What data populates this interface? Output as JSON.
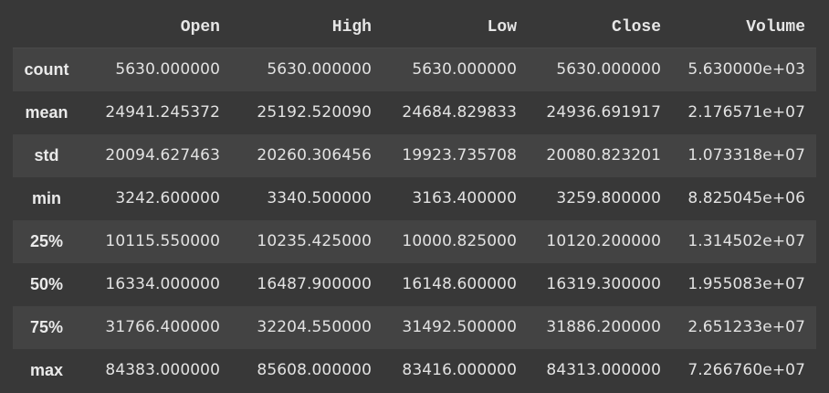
{
  "table": {
    "columns": [
      "Open",
      "High",
      "Low",
      "Close",
      "Volume"
    ],
    "rows": [
      {
        "label": "count",
        "values": [
          "5630.000000",
          "5630.000000",
          "5630.000000",
          "5630.000000",
          "5.630000e+03"
        ]
      },
      {
        "label": "mean",
        "values": [
          "24941.245372",
          "25192.520090",
          "24684.829833",
          "24936.691917",
          "2.176571e+07"
        ]
      },
      {
        "label": "std",
        "values": [
          "20094.627463",
          "20260.306456",
          "19923.735708",
          "20080.823201",
          "1.073318e+07"
        ]
      },
      {
        "label": "min",
        "values": [
          "3242.600000",
          "3340.500000",
          "3163.400000",
          "3259.800000",
          "8.825045e+06"
        ]
      },
      {
        "label": "25%",
        "values": [
          "10115.550000",
          "10235.425000",
          "10000.825000",
          "10120.200000",
          "1.314502e+07"
        ]
      },
      {
        "label": "50%",
        "values": [
          "16334.000000",
          "16487.900000",
          "16148.600000",
          "16319.300000",
          "1.955083e+07"
        ]
      },
      {
        "label": "75%",
        "values": [
          "31766.400000",
          "32204.550000",
          "31492.500000",
          "31886.200000",
          "2.651233e+07"
        ]
      },
      {
        "label": "max",
        "values": [
          "84383.000000",
          "85608.000000",
          "83416.000000",
          "84313.000000",
          "7.266760e+07"
        ]
      }
    ]
  }
}
